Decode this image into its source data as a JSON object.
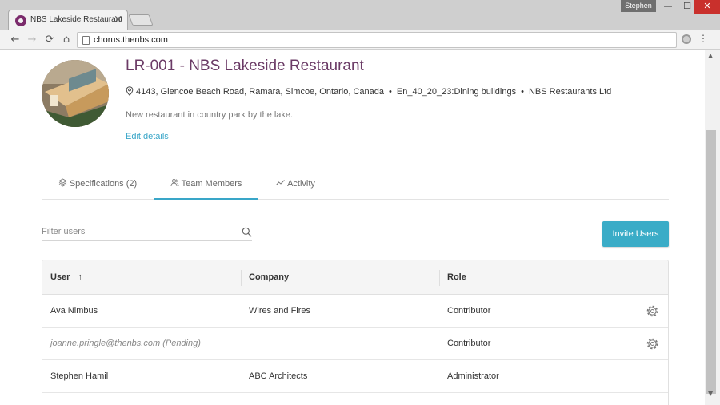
{
  "browser": {
    "tab_title": "NBS Lakeside Restaurant",
    "tab_close": "×",
    "user_name": "Stephen",
    "url": "chorus.thenbs.com",
    "window_min": "—",
    "window_max": "☐",
    "window_close": "✕",
    "nav_back": "←",
    "nav_forward": "→",
    "nav_reload": "⟳",
    "nav_home": "⌂",
    "menu": "⋮",
    "icons": [
      "favicon",
      "back-icon",
      "forward-icon",
      "reload-icon",
      "home-icon",
      "page-icon",
      "extension-icon",
      "menu-icon"
    ]
  },
  "project": {
    "title": "LR-001 - NBS Lakeside Restaurant",
    "address": "4143, Glencoe Beach Road, Ramara, Simcoe, Ontario, Canada",
    "classification": "En_40_20_23:Dining buildings",
    "client": "NBS Restaurants Ltd",
    "separator": "•",
    "description": "New restaurant in country park by the lake.",
    "edit_label": "Edit details"
  },
  "tabs": [
    {
      "label": "Specifications (2)",
      "icon": "layers-icon",
      "active": false
    },
    {
      "label": "Team Members",
      "icon": "users-icon",
      "active": true
    },
    {
      "label": "Activity",
      "icon": "activity-icon",
      "active": false
    }
  ],
  "filter": {
    "placeholder": "Filter users"
  },
  "invite_label": "Invite Users",
  "table": {
    "columns": [
      "User",
      "Company",
      "Role"
    ],
    "sort_indicator": "↑",
    "rows": [
      {
        "user": "Ava Nimbus",
        "company": "Wires and Fires",
        "role": "Contributor",
        "pending": false,
        "settings": true
      },
      {
        "user": "joanne.pringle@thenbs.com (Pending)",
        "company": "",
        "role": "Contributor",
        "pending": true,
        "settings": true
      },
      {
        "user": "Stephen Hamil",
        "company": "ABC Architects",
        "role": "Administrator",
        "pending": false,
        "settings": false
      }
    ]
  },
  "colors": {
    "title": "#6b3b66",
    "accent": "#3aacc7",
    "link": "#39a6c8",
    "close_button": "#c9302c"
  }
}
